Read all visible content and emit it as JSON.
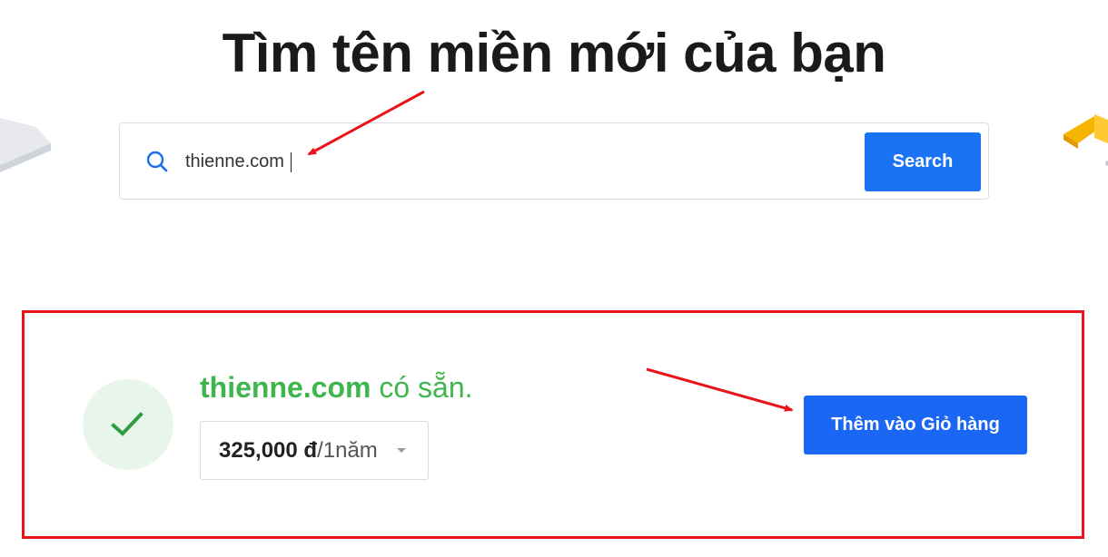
{
  "header": {
    "title": "Tìm tên miền mới của bạn"
  },
  "search": {
    "value": "thienne.com",
    "button_label": "Search"
  },
  "result": {
    "domain": "thienne.com",
    "status_text": " có sẵn.",
    "price_amount": "325,000 đ",
    "price_period": "/1năm",
    "add_to_cart_label": "Thêm vào Giỏ hàng"
  },
  "colors": {
    "accent": "#1a73f5",
    "available_green": "#3fb54e",
    "highlight_red": "#e8141a"
  },
  "icons": {
    "search": "search-icon",
    "check": "check-icon",
    "dropdown": "chevron-down-icon"
  }
}
